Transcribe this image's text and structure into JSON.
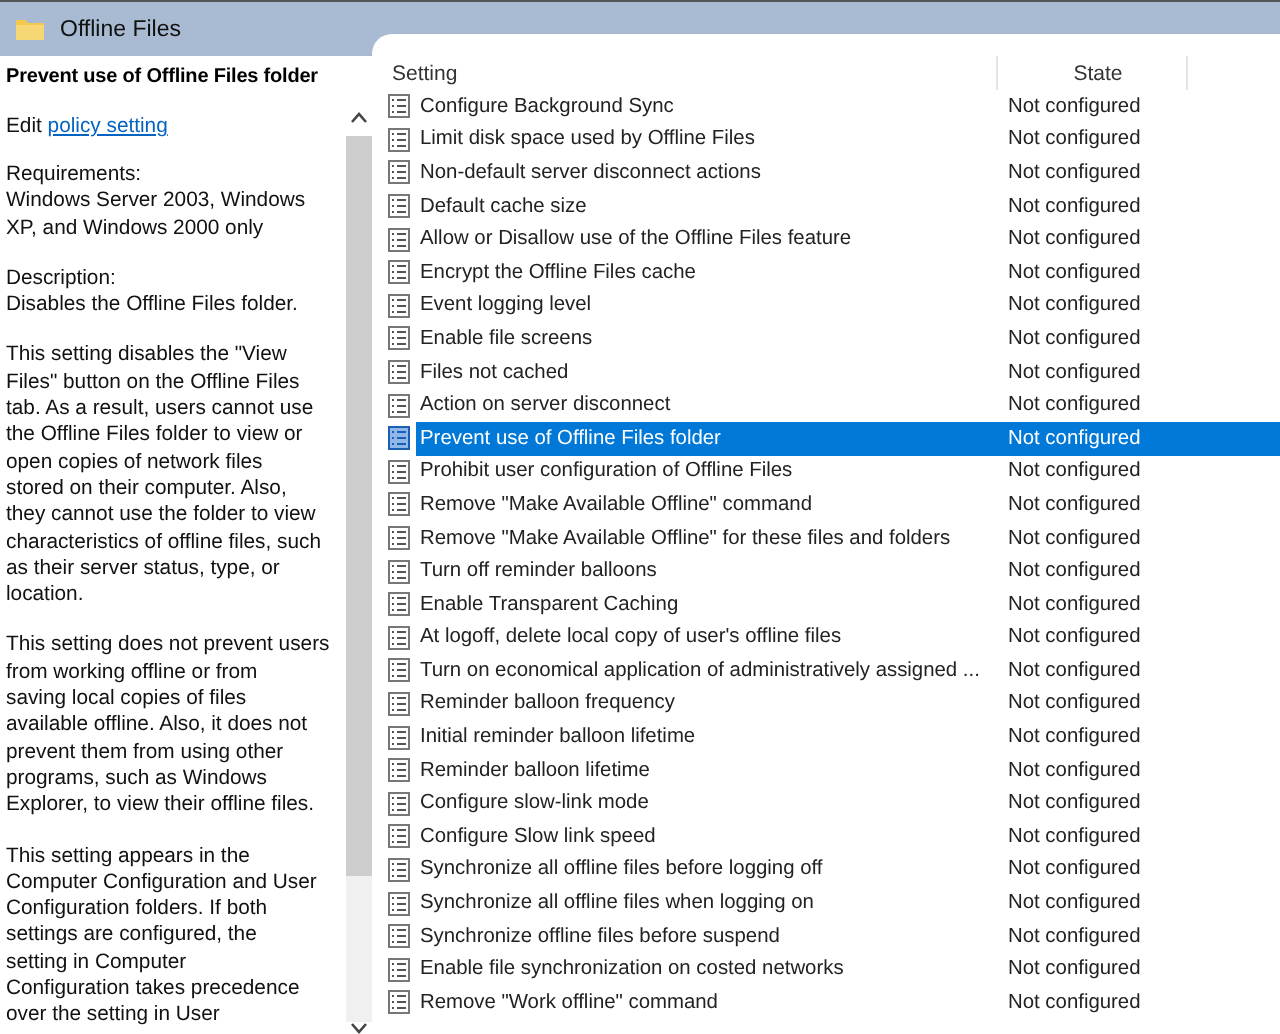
{
  "window": {
    "title": "Offline Files"
  },
  "details": {
    "title": "Prevent use of Offline Files folder",
    "edit_prefix": "Edit",
    "edit_link": "policy setting",
    "paragraphs": [
      "Requirements:\nWindows Server 2003, Windows\nXP, and Windows 2000 only",
      "Description:\nDisables the Offline Files folder.",
      "This setting disables the \"View\nFiles\" button on the Offline Files\ntab. As a result, users cannot use\nthe Offline Files folder to view or\nopen copies of network files\nstored on their computer. Also,\nthey cannot use the folder to view\ncharacteristics of offline files, such\nas their server status, type, or\nlocation.",
      "This setting does not prevent users\nfrom working offline or from\nsaving local copies of files\navailable offline. Also, it does not\nprevent them from using other\nprograms, such as Windows\nExplorer, to view their offline files.",
      "This setting appears in the\nComputer Configuration and User\nConfiguration folders. If both\nsettings are configured, the\nsetting in Computer\nConfiguration takes precedence\nover the setting in User"
    ]
  },
  "table": {
    "columns": [
      "Setting",
      "State"
    ],
    "rows": [
      {
        "setting": "Configure Background Sync",
        "state": "Not configured",
        "selected": false
      },
      {
        "setting": "Limit disk space used by Offline Files",
        "state": "Not configured",
        "selected": false
      },
      {
        "setting": "Non-default server disconnect actions",
        "state": "Not configured",
        "selected": false
      },
      {
        "setting": "Default cache size",
        "state": "Not configured",
        "selected": false
      },
      {
        "setting": "Allow or Disallow use of the Offline Files feature",
        "state": "Not configured",
        "selected": false
      },
      {
        "setting": "Encrypt the Offline Files cache",
        "state": "Not configured",
        "selected": false
      },
      {
        "setting": "Event logging level",
        "state": "Not configured",
        "selected": false
      },
      {
        "setting": "Enable file screens",
        "state": "Not configured",
        "selected": false
      },
      {
        "setting": "Files not cached",
        "state": "Not configured",
        "selected": false
      },
      {
        "setting": "Action on server disconnect",
        "state": "Not configured",
        "selected": false
      },
      {
        "setting": "Prevent use of Offline Files folder",
        "state": "Not configured",
        "selected": true
      },
      {
        "setting": "Prohibit user configuration of Offline Files",
        "state": "Not configured",
        "selected": false
      },
      {
        "setting": "Remove \"Make Available Offline\" command",
        "state": "Not configured",
        "selected": false
      },
      {
        "setting": "Remove \"Make Available Offline\" for these files and folders",
        "state": "Not configured",
        "selected": false
      },
      {
        "setting": "Turn off reminder balloons",
        "state": "Not configured",
        "selected": false
      },
      {
        "setting": "Enable Transparent Caching",
        "state": "Not configured",
        "selected": false
      },
      {
        "setting": "At logoff, delete local copy of user's offline files",
        "state": "Not configured",
        "selected": false
      },
      {
        "setting": "Turn on economical application of administratively assigned ...",
        "state": "Not configured",
        "selected": false
      },
      {
        "setting": "Reminder balloon frequency",
        "state": "Not configured",
        "selected": false
      },
      {
        "setting": "Initial reminder balloon lifetime",
        "state": "Not configured",
        "selected": false
      },
      {
        "setting": "Reminder balloon lifetime",
        "state": "Not configured",
        "selected": false
      },
      {
        "setting": "Configure slow-link mode",
        "state": "Not configured",
        "selected": false
      },
      {
        "setting": "Configure Slow link speed",
        "state": "Not configured",
        "selected": false
      },
      {
        "setting": "Synchronize all offline files before logging off",
        "state": "Not configured",
        "selected": false
      },
      {
        "setting": "Synchronize all offline files when logging on",
        "state": "Not configured",
        "selected": false
      },
      {
        "setting": "Synchronize offline files before suspend",
        "state": "Not configured",
        "selected": false
      },
      {
        "setting": "Enable file synchronization on costed networks",
        "state": "Not configured",
        "selected": false
      },
      {
        "setting": "Remove \"Work offline\" command",
        "state": "Not configured",
        "selected": false
      }
    ]
  }
}
